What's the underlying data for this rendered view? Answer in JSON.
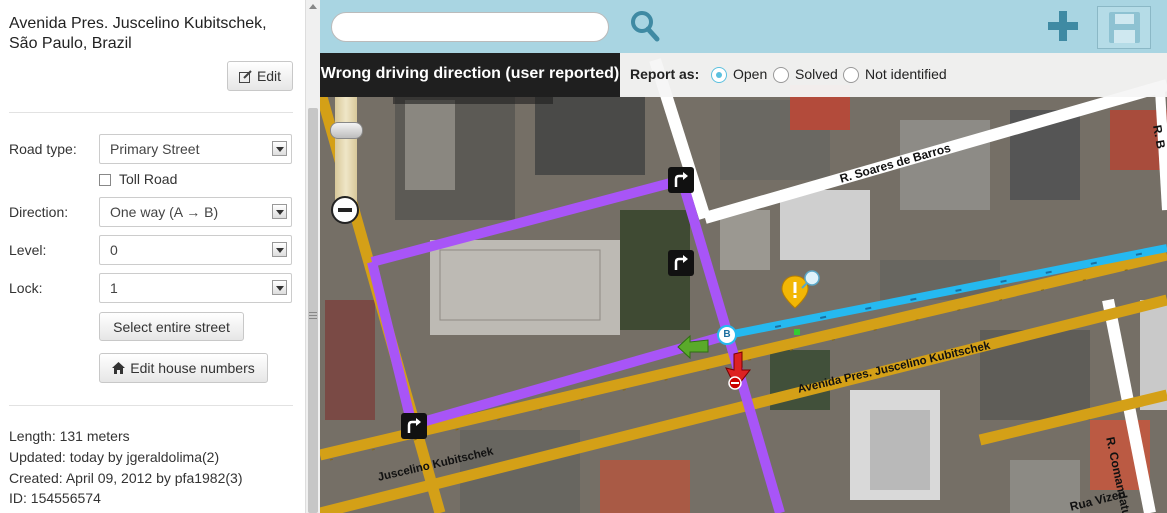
{
  "sidebar": {
    "address": "Avenida Pres. Juscelino Kubitschek, São Paulo, Brazil",
    "edit_label": "Edit",
    "road_type_label": "Road type:",
    "road_type_value": "Primary Street",
    "toll_label": "Toll Road",
    "direction_label": "Direction:",
    "direction_value": "One way (A → B)",
    "level_label": "Level:",
    "level_value": "0",
    "lock_label": "Lock:",
    "lock_value": "1",
    "select_street_label": "Select entire street",
    "house_numbers_label": "Edit house numbers",
    "length": "Length: 131 meters",
    "updated": "Updated: today by jgeraldolima(2)",
    "created": "Created: April 09, 2012 by pfa1982(3)",
    "id": "ID: 154556574"
  },
  "toolbar": {
    "search_value": "",
    "search_icon": "search-icon",
    "add_icon": "plus-icon",
    "save_icon": "save-icon"
  },
  "report": {
    "title": "Wrong driving direction (user reported)",
    "report_as": "Report as:",
    "options": [
      "Open",
      "Solved",
      "Not identified"
    ],
    "selected": "Open"
  },
  "map": {
    "ghost_label": "São Paulo, Brazil",
    "streets": {
      "avenue_main": "Avenida Pres. Juscelino Kubitschek",
      "avenue_bottom": "Juscelino Kubitschek",
      "soares": "R. Soares de Barros",
      "comandatuba": "R. Comandatuba",
      "vizeu": "Rua Vizeu",
      "top_right": "R. B"
    },
    "node_label": "B",
    "colors": {
      "primary_street": "#d4a017",
      "street": "#ffffff",
      "selected_segment": "#a855f7",
      "highlight": "#25b9f0",
      "toolbar": "#a9d5e2",
      "turn_arrow_green": "#5aaa2a",
      "turn_arrow_red": "#d22"
    }
  }
}
